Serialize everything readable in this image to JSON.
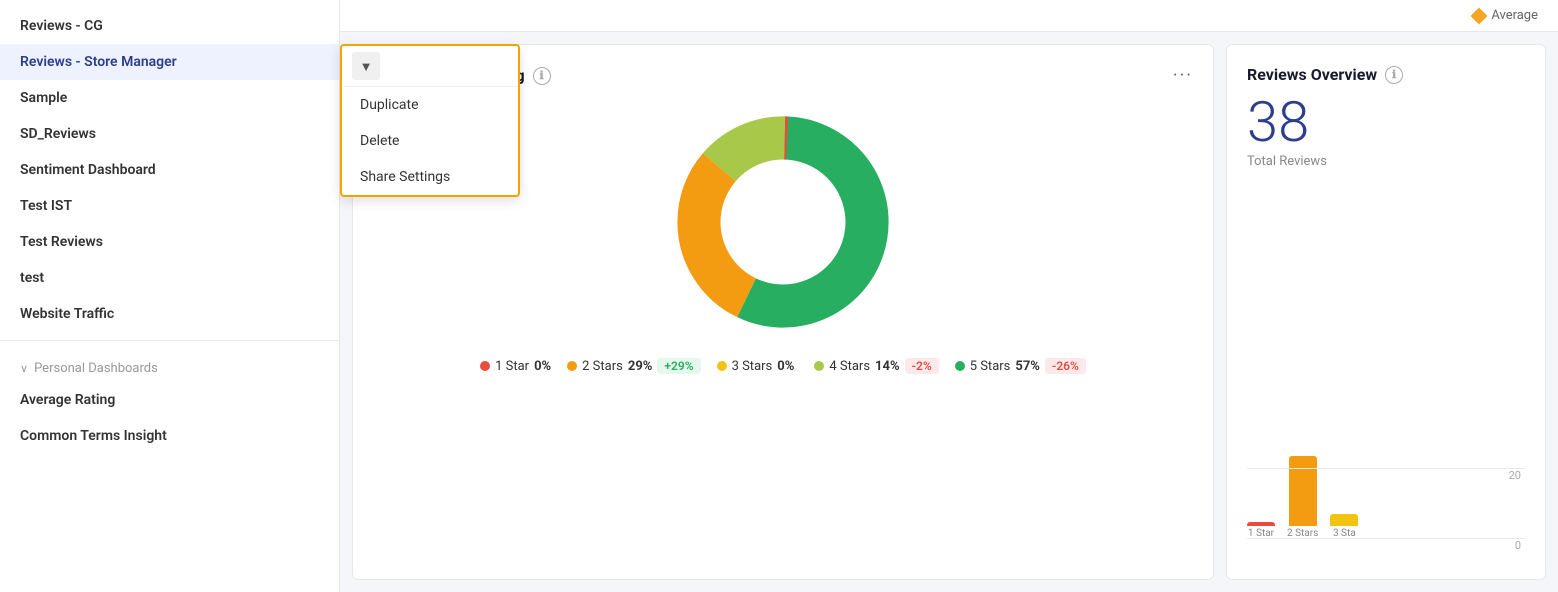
{
  "sidebar": {
    "items": [
      {
        "label": "Reviews - CG",
        "active": false
      },
      {
        "label": "Reviews - Store Manager",
        "active": true
      },
      {
        "label": "Sample",
        "active": false
      },
      {
        "label": "SD_Reviews",
        "active": false
      },
      {
        "label": "Sentiment Dashboard",
        "active": false
      },
      {
        "label": "Test IST",
        "active": false
      },
      {
        "label": "Test Reviews",
        "active": false
      },
      {
        "label": "test",
        "active": false
      },
      {
        "label": "Website Traffic",
        "active": false
      }
    ],
    "personalDashboards": {
      "label": "Personal Dashboards",
      "items": [
        {
          "label": "Average Rating"
        },
        {
          "label": "Common Terms Insight"
        }
      ]
    }
  },
  "dropdown": {
    "arrow_label": "▼",
    "items": [
      {
        "label": "Duplicate"
      },
      {
        "label": "Delete"
      },
      {
        "label": "Share Settings"
      }
    ]
  },
  "topbar": {
    "legend_label": "Average"
  },
  "chart_panel": {
    "title": "ns by Average Rating",
    "info_label": "ℹ",
    "more_label": "···",
    "donut": {
      "segments": [
        {
          "color": "#e74c3c",
          "pct": 0,
          "label": "1 Star",
          "value": 0,
          "startAngle": 0,
          "endAngle": 0
        },
        {
          "color": "#f39c12",
          "pct": 29,
          "label": "2 Stars",
          "value": 29,
          "badge": "+29%",
          "badge_type": "green"
        },
        {
          "color": "#f1c40f",
          "pct": 0,
          "label": "3 Stars",
          "value": 0
        },
        {
          "color": "#a8c84a",
          "pct": 14,
          "label": "4 Stars",
          "value": 14,
          "badge": "-2%",
          "badge_type": "pink"
        },
        {
          "color": "#27ae60",
          "pct": 57,
          "label": "5 Stars",
          "value": 57,
          "badge": "-26%",
          "badge_type": "pink"
        }
      ]
    },
    "legend": [
      {
        "color": "#e74c3c",
        "label": "1 Star",
        "pct": "0%"
      },
      {
        "color": "#f39c12",
        "label": "2 Stars",
        "pct": "29%",
        "badge": "+29%",
        "badge_type": "green"
      },
      {
        "color": "#f1c40f",
        "label": "3 Stars",
        "pct": "0%"
      },
      {
        "color": "#a8c84a",
        "label": "4 Stars",
        "pct": "14%",
        "badge": "-2%",
        "badge_type": "pink"
      },
      {
        "color": "#27ae60",
        "label": "5 Stars",
        "pct": "57%",
        "badge": "-26%",
        "badge_type": "pink"
      }
    ]
  },
  "overview_panel": {
    "title": "Reviews Overview",
    "info_label": "ℹ",
    "total": "38",
    "total_label": "Total Reviews",
    "y_labels": [
      "20",
      "0"
    ],
    "bars": [
      {
        "label": "1 Star",
        "height": 4,
        "color": "#e74c3c"
      },
      {
        "label": "2 Stars",
        "height": 70,
        "color": "#f39c12"
      },
      {
        "label": "3 Sta",
        "height": 12,
        "color": "#f1c40f"
      }
    ]
  }
}
